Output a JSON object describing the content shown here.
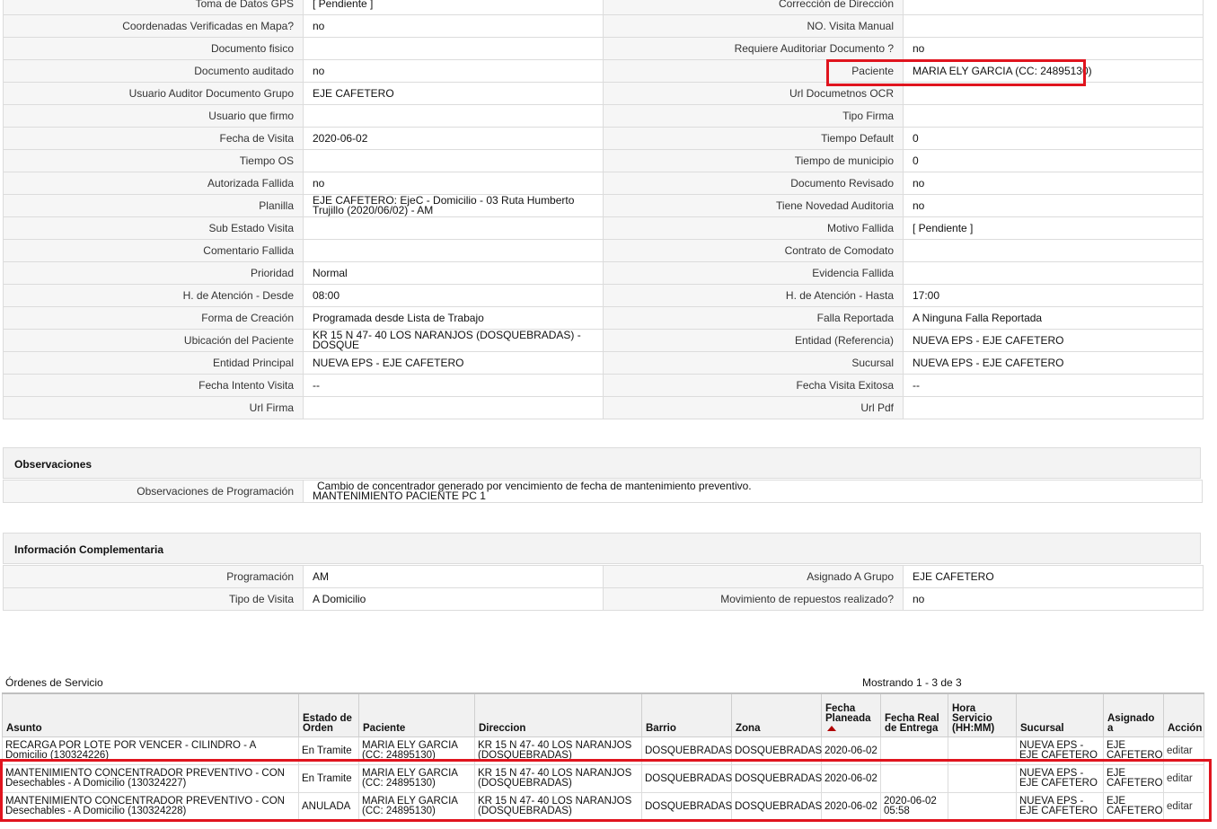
{
  "details": {
    "rows": [
      {
        "l1": "Toma de Datos GPS",
        "v1": "[ Pendiente ]",
        "l2": "Corrección de Dirección",
        "v2": ""
      },
      {
        "l1": "Coordenadas Verificadas en Mapa?",
        "v1": "no",
        "l2": "NO. Visita Manual",
        "v2": ""
      },
      {
        "l1": "Documento fisico",
        "v1": "",
        "l2": "Requiere Auditoriar Documento ?",
        "v2": "no"
      },
      {
        "l1": "Documento auditado",
        "v1": "no",
        "l2": "Paciente",
        "v2": "MARIA ELY GARCIA (CC: 24895130)"
      },
      {
        "l1": "Usuario Auditor Documento Grupo",
        "v1": "EJE CAFETERO",
        "l2": "Url Documetnos OCR",
        "v2": ""
      },
      {
        "l1": "Usuario que firmo",
        "v1": "",
        "l2": "Tipo Firma",
        "v2": ""
      },
      {
        "l1": "Fecha de Visita",
        "v1": "2020-06-02",
        "l2": "Tiempo Default",
        "v2": "0"
      },
      {
        "l1": "Tiempo OS",
        "v1": "",
        "l2": "Tiempo de municipio",
        "v2": "0"
      },
      {
        "l1": "Autorizada Fallida",
        "v1": "no",
        "l2": "Documento Revisado",
        "v2": "no"
      },
      {
        "l1": "Planilla",
        "v1": "EJE CAFETERO: EjeC - Domicilio - 03 Ruta Humberto Trujillo (2020/06/02) - AM",
        "l2": "Tiene Novedad Auditoria",
        "v2": "no"
      },
      {
        "l1": "Sub Estado Visita",
        "v1": "",
        "l2": "Motivo Fallida",
        "v2": "[ Pendiente ]"
      },
      {
        "l1": "Comentario Fallida",
        "v1": "",
        "l2": "Contrato de Comodato",
        "v2": ""
      },
      {
        "l1": "Prioridad",
        "v1": "Normal",
        "l2": "Evidencia Fallida",
        "v2": ""
      },
      {
        "l1": "H. de Atención - Desde",
        "v1": "08:00",
        "l2": "H. de Atención - Hasta",
        "v2": "17:00"
      },
      {
        "l1": "Forma de Creación",
        "v1": "Programada desde Lista de Trabajo",
        "l2": "Falla Reportada",
        "v2": "A Ninguna Falla Reportada"
      },
      {
        "l1": "Ubicación del Paciente",
        "v1": "KR 15 N 47- 40 LOS NARANJOS (DOSQUEBRADAS) - DOSQUE",
        "l2": "Entidad (Referencia)",
        "v2": "NUEVA EPS - EJE CAFETERO"
      },
      {
        "l1": "Entidad Principal",
        "v1": "NUEVA EPS - EJE CAFETERO",
        "l2": "Sucursal",
        "v2": "NUEVA EPS - EJE CAFETERO"
      },
      {
        "l1": "Fecha Intento Visita",
        "v1": "--",
        "l2": "Fecha Visita Exitosa",
        "v2": "--"
      },
      {
        "l1": "Url Firma",
        "v1": "",
        "l2": "Url Pdf",
        "v2": ""
      }
    ]
  },
  "observaciones": {
    "title": "Observaciones",
    "label": "Observaciones de Programación",
    "line1": "Cambio de concentrador generado por vencimiento de fecha de mantenimiento preventivo.",
    "line2": "MANTENIMIENTO PACIENTE PC 1"
  },
  "complementaria": {
    "title": "Información Complementaria",
    "rows": [
      {
        "l1": "Programación",
        "v1": "AM",
        "l2": "Asignado A Grupo",
        "v2": "EJE CAFETERO"
      },
      {
        "l1": "Tipo de Visita",
        "v1": "A Domicilio",
        "l2": "Movimiento de repuestos realizado?",
        "v2": "no"
      }
    ]
  },
  "orders": {
    "title": "Órdenes de Servicio",
    "count": "Mostrando 1 - 3 de 3",
    "headers": [
      "Asunto",
      "Estado de Orden",
      "Paciente",
      "Direccion",
      "Barrio",
      "Zona",
      "Fecha Planeada",
      "Fecha Real de Entrega",
      "Hora Servicio (HH:MM)",
      "Sucursal",
      "Asignado a",
      "Acción"
    ],
    "rows": [
      {
        "asunto": "RECARGA POR LOTE POR VENCER - CILINDRO - A Domicilio (130324226)",
        "estado": "En Tramite",
        "paciente": "MARIA ELY GARCIA (CC: 24895130)",
        "direccion": "KR 15 N 47- 40 LOS NARANJOS (DOSQUEBRADAS)",
        "barrio": "DOSQUEBRADAS",
        "zona": "DOSQUEBRADAS",
        "fecha_planeada": "2020-06-02",
        "fecha_real": "",
        "hora": "",
        "sucursal": "NUEVA EPS - EJE CAFETERO",
        "asignado": "EJE CAFETERO",
        "accion": "editar"
      },
      {
        "asunto": "MANTENIMIENTO CONCENTRADOR PREVENTIVO - CON Desechables - A Domicilio (130324227)",
        "estado": "En Tramite",
        "paciente": "MARIA ELY GARCIA (CC: 24895130)",
        "direccion": "KR 15 N 47- 40 LOS NARANJOS (DOSQUEBRADAS)",
        "barrio": "DOSQUEBRADAS",
        "zona": "DOSQUEBRADAS",
        "fecha_planeada": "2020-06-02",
        "fecha_real": "",
        "hora": "",
        "sucursal": "NUEVA EPS - EJE CAFETERO",
        "asignado": "EJE CAFETERO",
        "accion": "editar"
      },
      {
        "asunto": "MANTENIMIENTO CONCENTRADOR PREVENTIVO - CON Desechables - A Domicilio (130324228)",
        "estado": "ANULADA",
        "paciente": "MARIA ELY GARCIA (CC: 24895130)",
        "direccion": "KR 15 N 47- 40 LOS NARANJOS (DOSQUEBRADAS)",
        "barrio": "DOSQUEBRADAS",
        "zona": "DOSQUEBRADAS",
        "fecha_planeada": "2020-06-02",
        "fecha_real": "2020-06-02 05:58",
        "hora": "",
        "sucursal": "NUEVA EPS - EJE CAFETERO",
        "asignado": "EJE CAFETERO",
        "accion": "editar"
      }
    ]
  },
  "colors": {
    "highlight": "#e0141e",
    "sort_arrow": "#b00000"
  }
}
